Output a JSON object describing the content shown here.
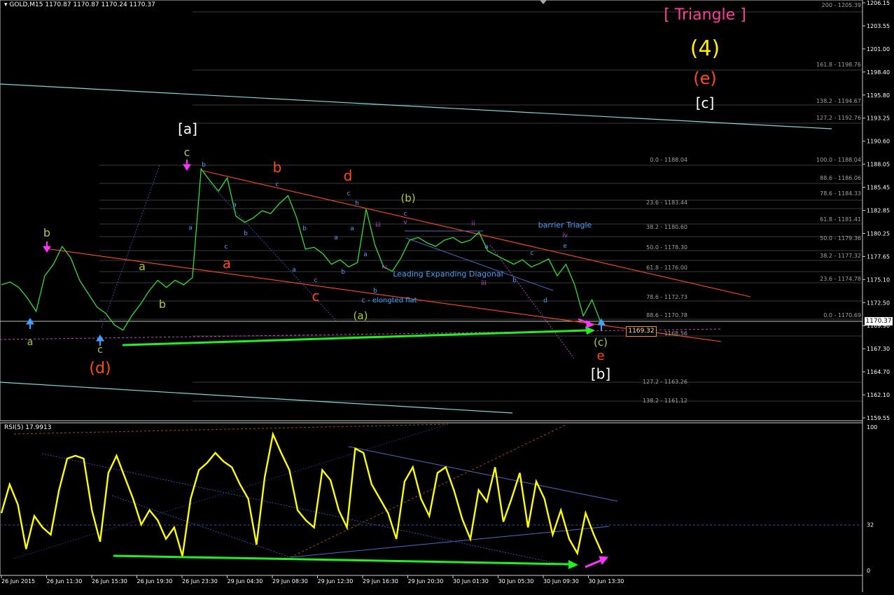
{
  "header": {
    "symbol_line": "GOLD,M15  1170.87 1170.87 1170.24 1170.37"
  },
  "rsi_header": {
    "label": "RSI(5) 17.9913"
  },
  "current_price": "1170.37",
  "price_box": "1169.32",
  "chart_data": [
    {
      "type": "line",
      "panel": "price",
      "y_axis_ticks": [
        "1206.15",
        "1203.55",
        "1201.00",
        "1198.40",
        "1195.80",
        "1193.25",
        "1190.60",
        "1188.05",
        "1185.45",
        "1182.85",
        "1180.25",
        "1177.65",
        "1175.10",
        "1172.50",
        "1169.90",
        "1167.30",
        "1164.70",
        "1162.10",
        "1159.55"
      ],
      "ylim": [
        1159.55,
        1206.15
      ],
      "x_tick_labels": [
        "26 Jun 2015",
        "26 Jun 11:30",
        "26 Jun 15:30",
        "26 Jun 19:30",
        "26 Jun 23:30",
        "29 Jun 04:30",
        "29 Jun 08:30",
        "29 Jun 12:30",
        "29 Jun 16:30",
        "29 Jun 20:30",
        "30 Jun 01:30",
        "30 Jun 05:30",
        "30 Jun 09:30",
        "30 Jun 13:30"
      ],
      "series": [
        {
          "values": [
            1174.5,
            1174.8,
            1174.2,
            1173.0,
            1171.5,
            1175.5,
            1176.8,
            1178.8,
            1177.5,
            1175.0,
            1173.5,
            1172.0,
            1171.3,
            1170.0,
            1169.4,
            1171.0,
            1172.3,
            1173.8,
            1175.0,
            1174.2,
            1175.0,
            1174.5,
            1175.3,
            1187.5,
            1186.2,
            1185.0,
            1186.5,
            1182.2,
            1181.5,
            1182.0,
            1182.8,
            1182.5,
            1183.6,
            1184.5,
            1182.0,
            1178.5,
            1178.7,
            1178.0,
            1176.8,
            1177.3,
            1176.5,
            1177.0,
            1183.0,
            1179.0,
            1176.5,
            1176.0,
            1177.5,
            1179.5,
            1179.8,
            1179.2,
            1178.8,
            1179.5,
            1179.8,
            1179.2,
            1179.5,
            1180.4,
            1178.3,
            1177.8,
            1177.3,
            1176.8,
            1177.3,
            1176.5,
            1176.9,
            1177.4,
            1175.5,
            1176.8,
            1174.5,
            1171.0,
            1172.8,
            1170.3
          ]
        }
      ],
      "fib_levels_right": [
        "200 - 1205.39",
        "161.8 - 1198.76",
        "138.2 - 1194.67",
        "127.2 - 1192.76",
        "100.0 - 1188.04",
        "88.6 - 1186.06",
        "78.6 - 1184.33",
        "61.8 - 1181.41",
        "50.0 - 1179.36",
        "38.2 - 1177.32",
        "23.6 - 1174.78",
        "0.0 - 1170.69"
      ],
      "fib_levels_mid": [
        "0.0 - 1188.04",
        "23.6 - 1183.44",
        "38.2 - 1180.60",
        "50.0 - 1178.30",
        "61.8 - 1176.00",
        "78.6 - 1172.73",
        "88.6 - 1170.78",
        "- 1168.56",
        "127.2 - 1163.26",
        "138.2 - 1161.12"
      ],
      "annotations": {
        "triangle": "[ Triangle ]",
        "four": "(4)",
        "e_paren": "(e)",
        "c_bracket": "[c]",
        "a_bracket": "[a]",
        "b_bracket": "[b]",
        "d_paren": "(d)",
        "b_paren": "(b)",
        "a_paren": "(a)",
        "c_paren": "(c)",
        "elongated": "c - elongted flat",
        "leading": "Leading Expanding Diagonal",
        "barrier": "barrier Triagle"
      }
    },
    {
      "type": "line",
      "panel": "rsi",
      "y_axis_ticks": [
        "100",
        "32",
        "0"
      ],
      "ylim": [
        0,
        100
      ],
      "series": [
        {
          "values": [
            40,
            60,
            46,
            15,
            38,
            30,
            25,
            56,
            78,
            80,
            78,
            42,
            20,
            68,
            80,
            65,
            50,
            32,
            42,
            35,
            22,
            30,
            10,
            50,
            70,
            75,
            82,
            76,
            72,
            60,
            50,
            18,
            65,
            95,
            82,
            70,
            42,
            35,
            30,
            70,
            63,
            42,
            30,
            85,
            82,
            60,
            50,
            40,
            22,
            62,
            72,
            50,
            38,
            68,
            72,
            56,
            36,
            22,
            56,
            48,
            72,
            34,
            50,
            68,
            30,
            62,
            50,
            25,
            42,
            22,
            12,
            40,
            25,
            12
          ]
        }
      ]
    }
  ]
}
